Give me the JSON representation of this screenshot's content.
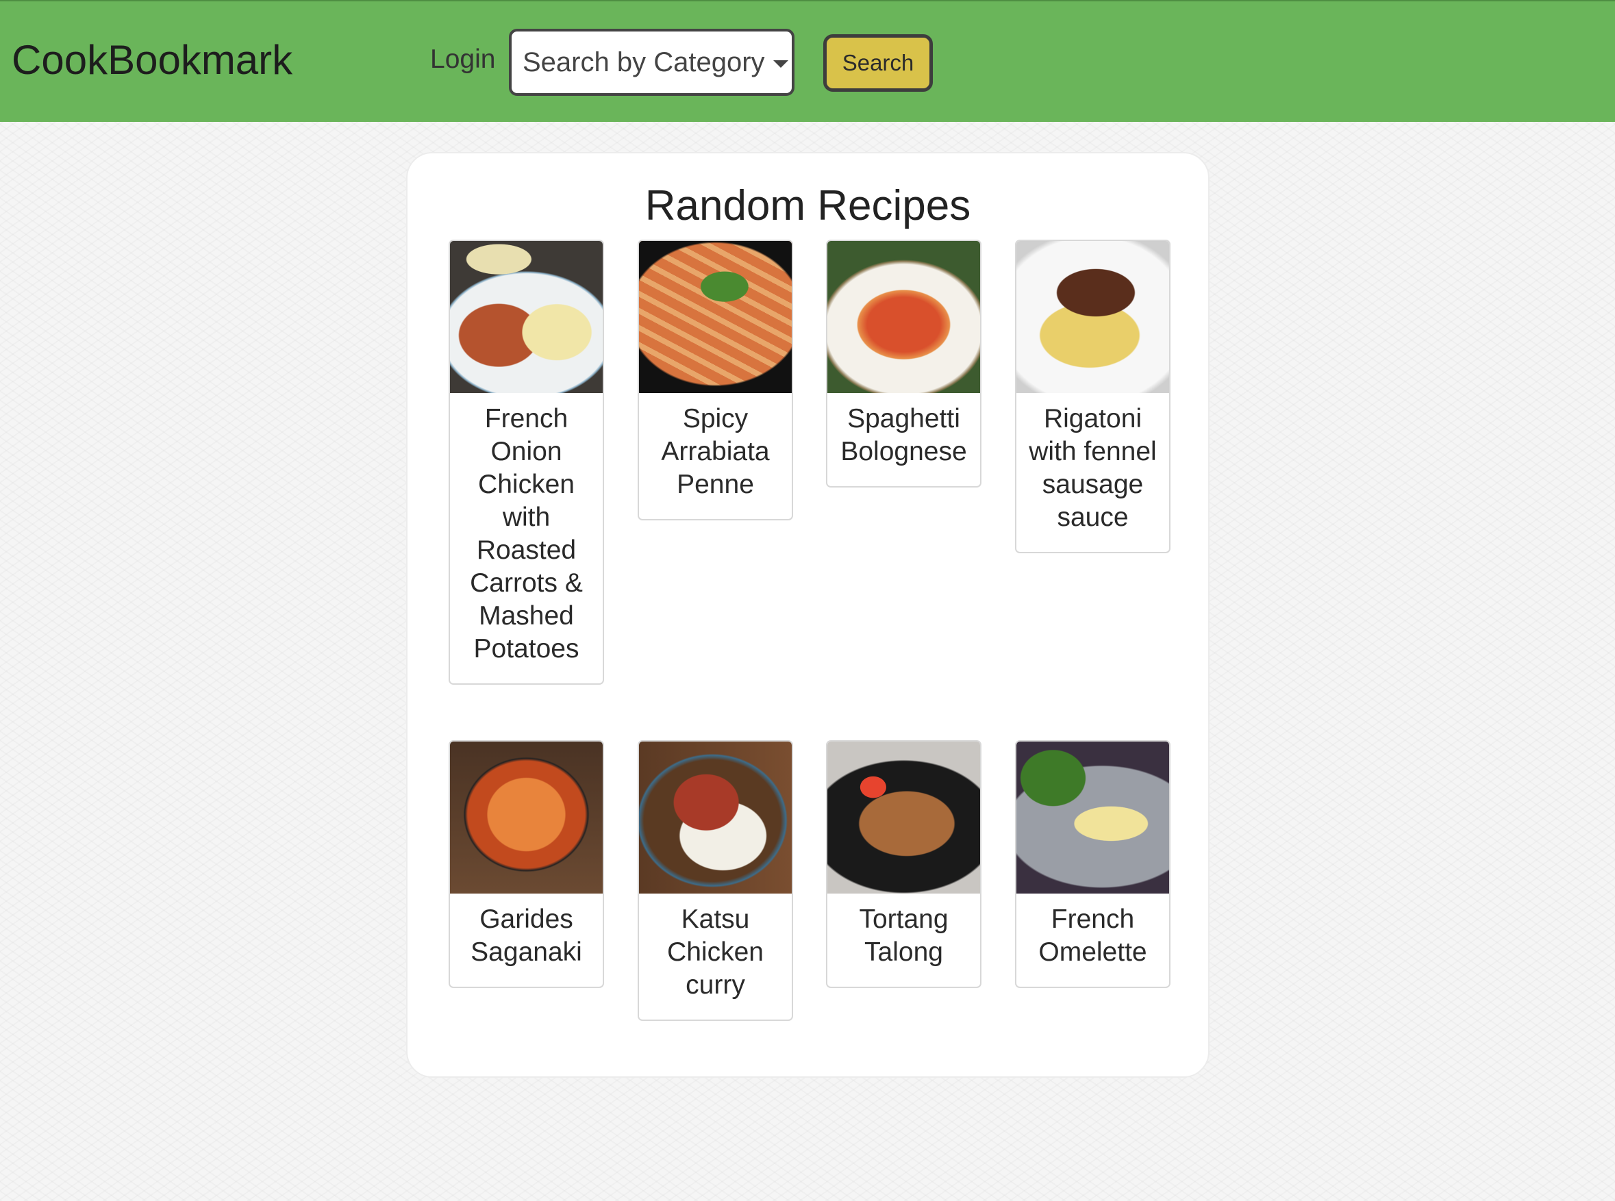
{
  "navbar": {
    "brand": "CookBookmark",
    "login_label": "Login",
    "category_select_label": "Search by Category",
    "search_button_label": "Search"
  },
  "main": {
    "title": "Random Recipes",
    "recipes": [
      {
        "title": "French Onion Chicken with Roasted Carrots & Mashed Potatoes"
      },
      {
        "title": "Spicy Arrabiata Penne"
      },
      {
        "title": "Spaghetti Bolognese"
      },
      {
        "title": "Rigatoni with fennel sausage sauce"
      },
      {
        "title": "Garides Saganaki"
      },
      {
        "title": "Katsu Chicken curry"
      },
      {
        "title": "Tortang Talong"
      },
      {
        "title": "French Omelette"
      }
    ]
  },
  "colors": {
    "navbar_bg": "#6ab55a",
    "search_button_bg": "#d9c24a",
    "page_bg": "#f5f5f5"
  }
}
